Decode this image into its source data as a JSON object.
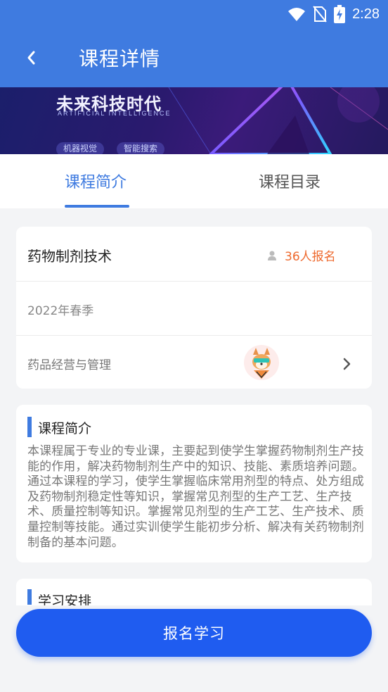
{
  "status_bar": {
    "time": "2:28"
  },
  "header": {
    "title": "课程详情",
    "back_icon": "chevron-left-icon"
  },
  "banner": {
    "title": "未来科技时代",
    "subtitle": "ARTIFICIAL INTELLIGENCE",
    "tags": [
      "机器视觉",
      "智能搜索"
    ]
  },
  "tabs": [
    {
      "label": "课程简介",
      "active": true
    },
    {
      "label": "课程目录",
      "active": false
    }
  ],
  "course": {
    "name": "药物制剂技术",
    "enroll_count": "36人报名",
    "term": "2022年春季",
    "major": "药品经营与管理"
  },
  "intro": {
    "title": "课程简介",
    "text": "本课程属于专业的专业课，主要起到使学生掌握药物制剂生产技能的作用，解决药物制剂生产中的知识、技能、素质培养问题。通过本课程的学习，使学生掌握临床常用剂型的特点、处方组成及药物制剂稳定性等知识，掌握常见剂型的生产工艺、生产技术、质量控制等知识。掌握常见剂型的生产工艺、生产技术、质量控制等技能。通过实训使学生能初步分析、解决有关药物制剂制备的基本问题。"
  },
  "schedule": {
    "title": "学习安排"
  },
  "action": {
    "label": "报名学习"
  },
  "colors": {
    "primary": "#3f7be0",
    "button": "#1f5cf0",
    "enroll": "#ee6a2f",
    "background": "#f3f4f6"
  }
}
